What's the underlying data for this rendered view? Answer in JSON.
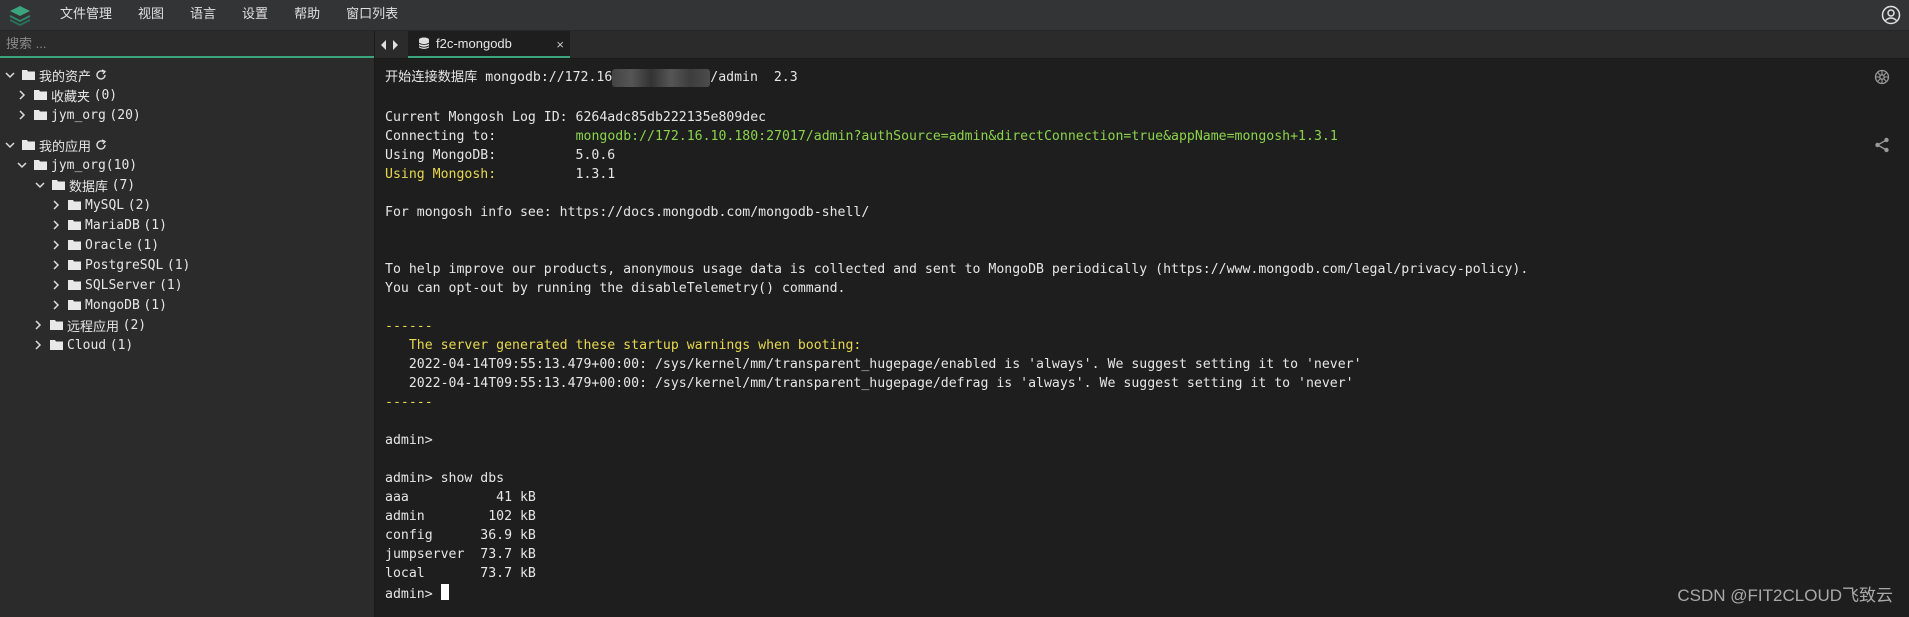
{
  "menubar": {
    "items": [
      "文件管理",
      "视图",
      "语言",
      "设置",
      "帮助",
      "窗口列表"
    ]
  },
  "sidebar": {
    "search_placeholder": "搜索 ...",
    "tree": [
      {
        "label": "我的资产",
        "count": "",
        "state": "expanded",
        "refresh": true
      },
      {
        "label": "收藏夹",
        "count": "(0)",
        "state": "collapsed"
      },
      {
        "label": "jym_org",
        "count": "(20)",
        "state": "collapsed"
      },
      {
        "label": "我的应用",
        "count": "",
        "state": "expanded",
        "refresh": true
      },
      {
        "label": "jym_org(10)",
        "count": "",
        "state": "expanded"
      },
      {
        "label": "数据库",
        "count": "(7)",
        "state": "expanded"
      },
      {
        "label": "MySQL",
        "count": "(2)",
        "state": "collapsed"
      },
      {
        "label": "MariaDB",
        "count": "(1)",
        "state": "collapsed"
      },
      {
        "label": "Oracle",
        "count": "(1)",
        "state": "collapsed"
      },
      {
        "label": "PostgreSQL",
        "count": "(1)",
        "state": "collapsed"
      },
      {
        "label": "SQLServer",
        "count": "(1)",
        "state": "collapsed"
      },
      {
        "label": "MongoDB",
        "count": "(1)",
        "state": "collapsed"
      },
      {
        "label": "远程应用",
        "count": "(2)",
        "state": "collapsed"
      },
      {
        "label": "Cloud",
        "count": "(1)",
        "state": "collapsed"
      }
    ]
  },
  "tabs": {
    "active_label": "f2c-mongodb",
    "close_glyph": "×"
  },
  "terminal": {
    "connect_prefix": "开始连接数据库 mongodb://172.16",
    "connect_suffix": "/admin  2.3",
    "log_id_line": "Current Mongosh Log ID: 6264adc85db222135e809dec",
    "connecting_label": "Connecting to:          ",
    "connecting_url": "mongodb://172.16.10.180:27017/admin?authSource=admin&directConnection=true&appName=mongosh+1.3.1",
    "using_mongodb_line": "Using MongoDB:          5.0.6",
    "using_mongosh_label": "Using Mongosh:",
    "using_mongosh_value": "          1.3.1",
    "info_line": "For mongosh info see: https://docs.mongodb.com/mongodb-shell/",
    "telemetry_line1": "To help improve our products, anonymous usage data is collected and sent to MongoDB periodically (https://www.mongodb.com/legal/privacy-policy).",
    "telemetry_line2": "You can opt-out by running the disableTelemetry() command.",
    "separator": "------",
    "warnings_header": "   The server generated these startup warnings when booting:",
    "warning1": "   2022-04-14T09:55:13.479+00:00: /sys/kernel/mm/transparent_hugepage/enabled is 'always'. We suggest setting it to 'never'",
    "warning2": "   2022-04-14T09:55:13.479+00:00: /sys/kernel/mm/transparent_hugepage/defrag is 'always'. We suggest setting it to 'never'",
    "prompt1": "admin>",
    "command": "admin> show dbs",
    "dbs": [
      "aaa           41 kB",
      "admin        102 kB",
      "config      36.9 kB",
      "jumpserver  73.7 kB",
      "local       73.7 kB"
    ],
    "final_prompt": "admin> "
  },
  "watermark": "CSDN @FIT2CLOUD飞致云",
  "colors": {
    "accent": "#3ba57e",
    "terminal_bg": "#1e1e1e",
    "url_green": "#8bd44a",
    "warning_yellow": "#e7d84f"
  }
}
